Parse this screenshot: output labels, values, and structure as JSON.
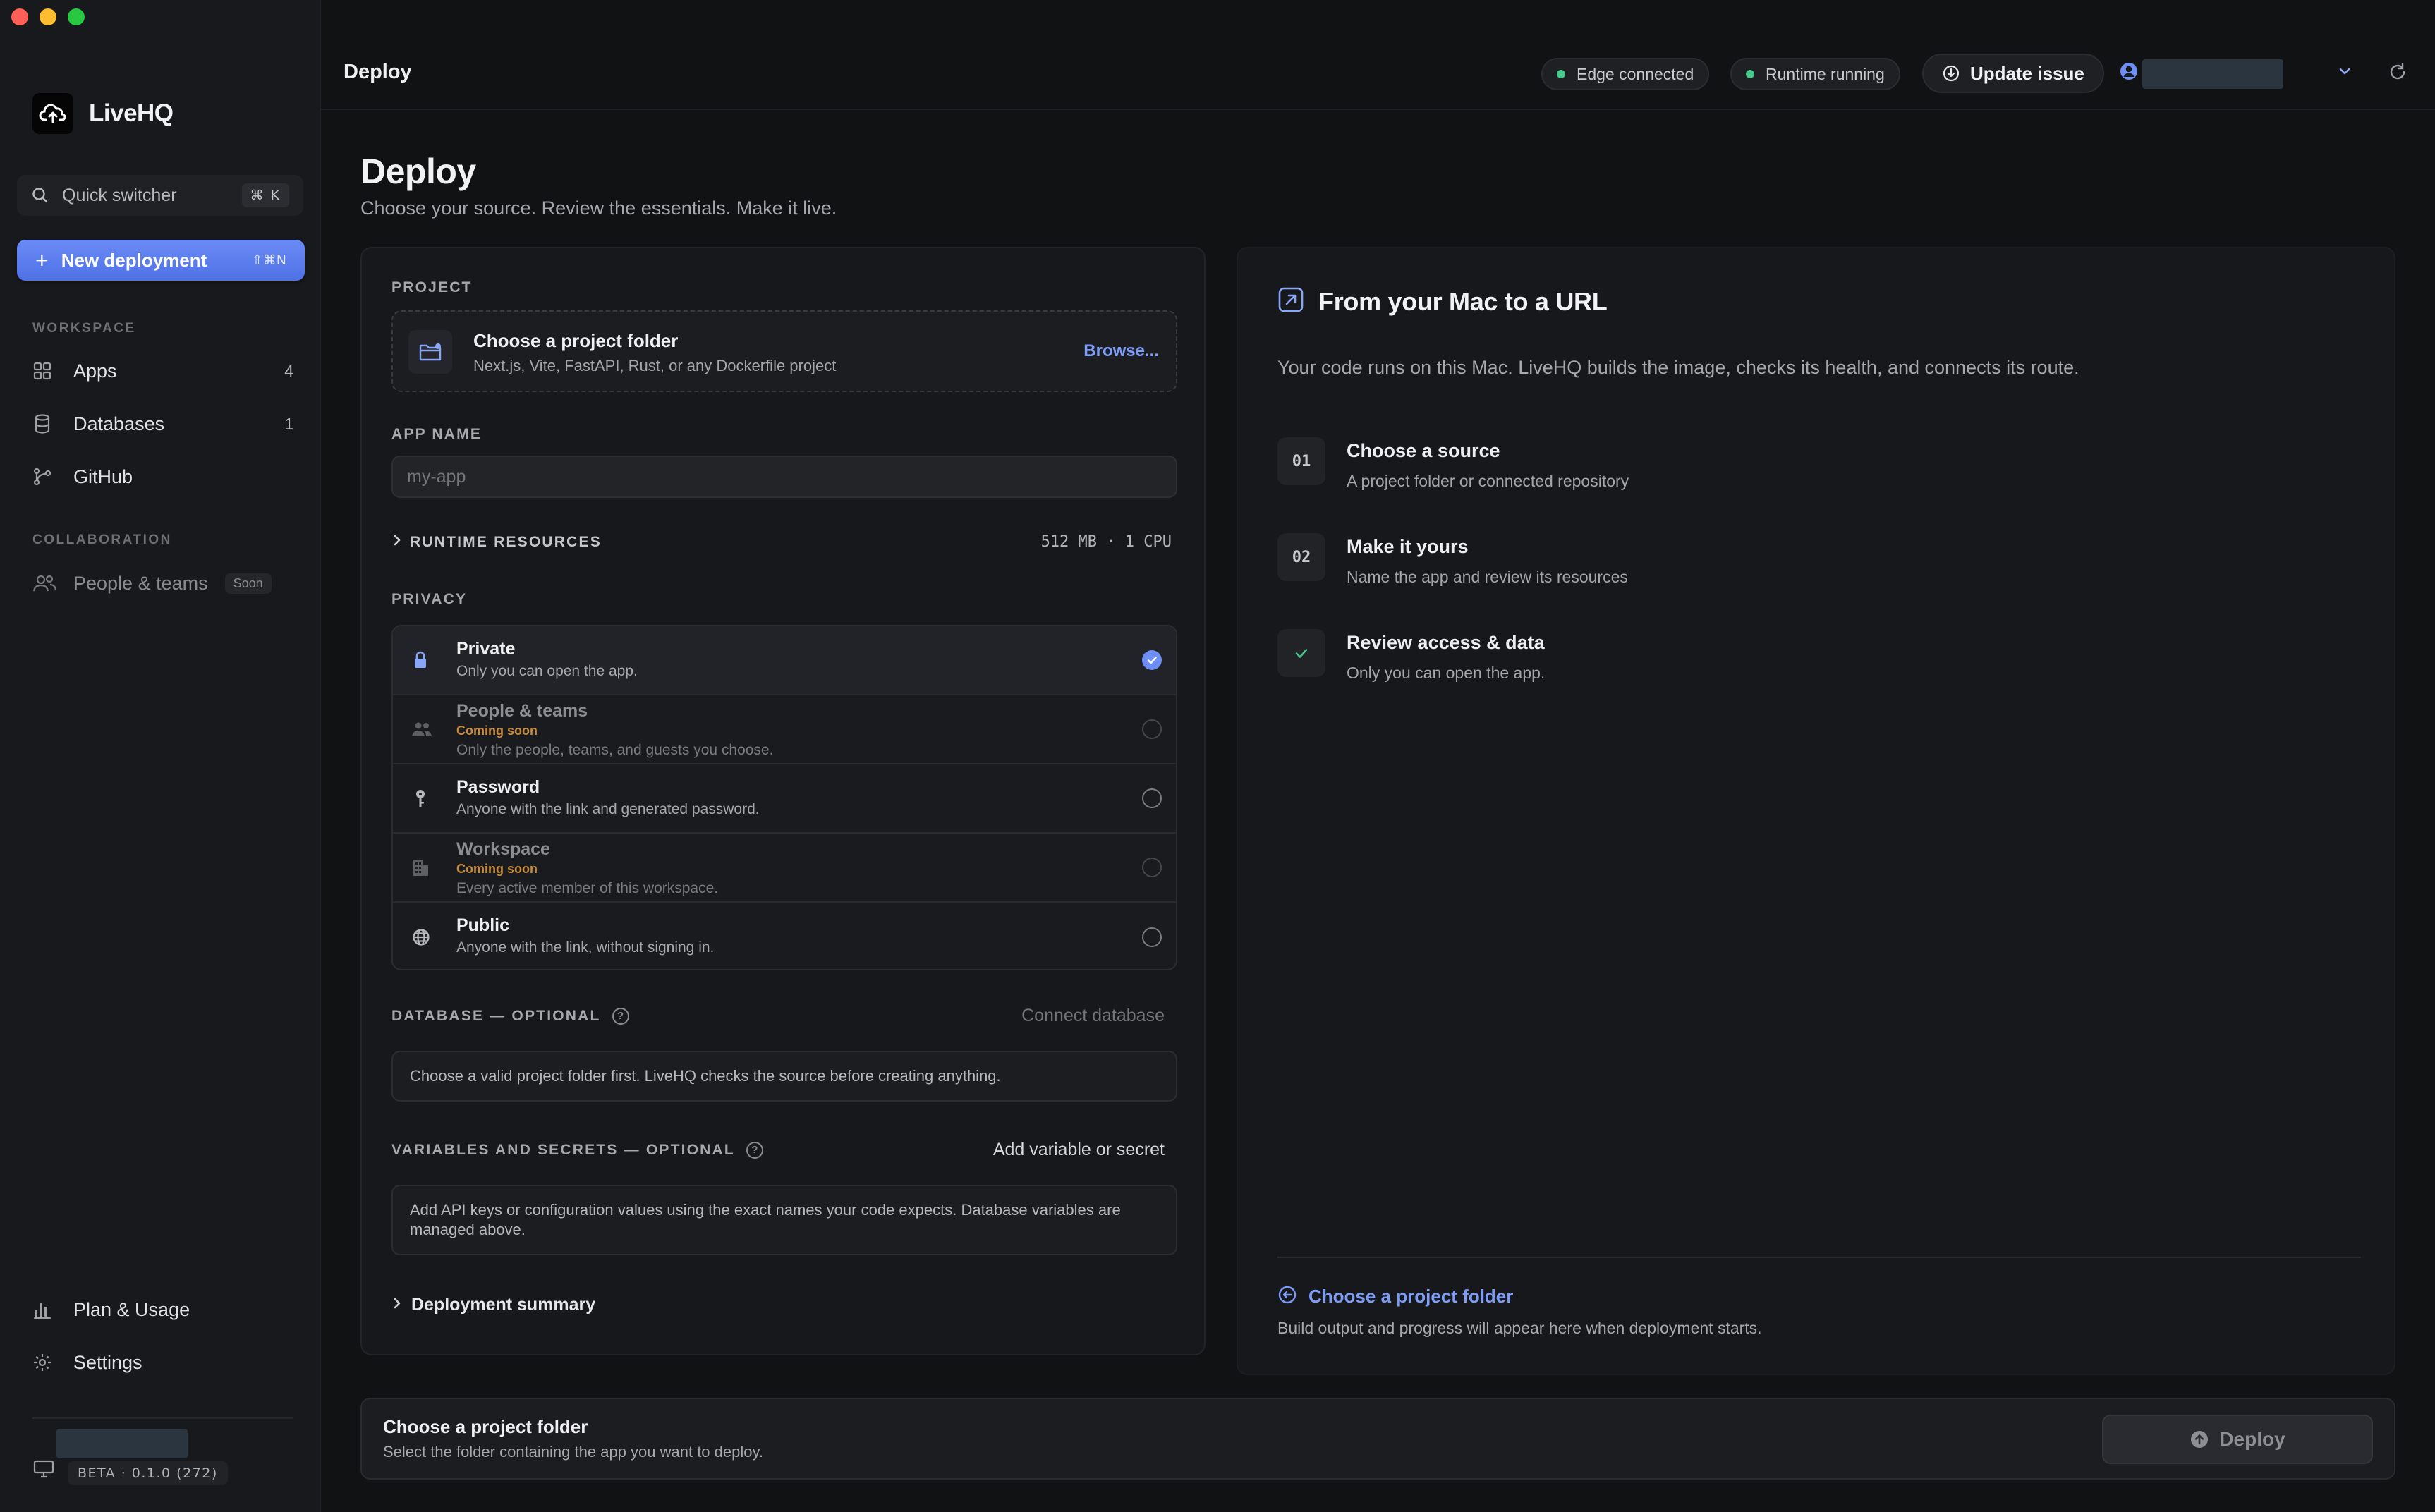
{
  "app": {
    "name": "LiveHQ"
  },
  "sidebar": {
    "quick_switcher": {
      "label": "Quick switcher",
      "shortcut": "⌘ K"
    },
    "new_deployment": {
      "label": "New deployment",
      "shortcut": "⇧⌘N"
    },
    "workspace_label": "WORKSPACE",
    "workspace_items": [
      {
        "label": "Apps",
        "count": "4",
        "icon": "apps-grid-icon"
      },
      {
        "label": "Databases",
        "count": "1",
        "icon": "database-icon"
      },
      {
        "label": "GitHub",
        "count": "",
        "icon": "github-branch-icon"
      }
    ],
    "collaboration_label": "COLLABORATION",
    "collaboration_items": [
      {
        "label": "People & teams",
        "badge": "Soon",
        "icon": "people-icon"
      }
    ],
    "bottom_items": [
      {
        "label": "Plan & Usage",
        "icon": "bar-chart-icon"
      },
      {
        "label": "Settings",
        "icon": "gear-icon"
      }
    ],
    "version": "BETA · 0.1.0 (272)"
  },
  "topbar": {
    "title": "Deploy",
    "status_edge": "Edge connected",
    "status_runtime": "Runtime running",
    "update_button": "Update issue",
    "status_color": "#46c98a"
  },
  "page": {
    "title": "Deploy",
    "subtitle": "Choose your source. Review the essentials. Make it live."
  },
  "form": {
    "project_label": "PROJECT",
    "project_title": "Choose a project folder",
    "project_subtitle": "Next.js, Vite, FastAPI, Rust, or any Dockerfile project",
    "browse_label": "Browse...",
    "app_name_label": "APP NAME",
    "app_name_placeholder": "my-app",
    "app_name_value": "",
    "runtime_label": "RUNTIME RESOURCES",
    "runtime_value": "512 MB · 1 CPU",
    "privacy_label": "PRIVACY",
    "privacy_options": [
      {
        "title": "Private",
        "soon": "",
        "desc": "Only you can open the app.",
        "selected": true,
        "disabled": false,
        "icon": "lock-icon"
      },
      {
        "title": "People & teams",
        "soon": "Coming soon",
        "desc": "Only the people, teams, and guests you choose.",
        "selected": false,
        "disabled": true,
        "icon": "people-icon"
      },
      {
        "title": "Password",
        "soon": "",
        "desc": "Anyone with the link and generated password.",
        "selected": false,
        "disabled": false,
        "icon": "key-icon"
      },
      {
        "title": "Workspace",
        "soon": "Coming soon",
        "desc": "Every active member of this workspace.",
        "selected": false,
        "disabled": true,
        "icon": "building-icon"
      },
      {
        "title": "Public",
        "soon": "",
        "desc": "Anyone with the link, without signing in.",
        "selected": false,
        "disabled": false,
        "icon": "globe-icon"
      }
    ],
    "database_label": "DATABASE — OPTIONAL",
    "database_action": "Connect database",
    "database_note": "Choose a valid project folder first. LiveHQ checks the source before creating anything.",
    "variables_label": "VARIABLES AND SECRETS — OPTIONAL",
    "variables_action": "Add variable or secret",
    "variables_note": "Add API keys or configuration values using the exact names your code expects. Database variables are managed above.",
    "summary_label": "Deployment summary"
  },
  "info": {
    "title": "From your Mac to a URL",
    "description": "Your code runs on this Mac. LiveHQ builds the image, checks its health, and connects its route.",
    "steps": [
      {
        "badge": "01",
        "title": "Choose a source",
        "desc": "A project folder or connected repository"
      },
      {
        "badge": "02",
        "title": "Make it yours",
        "desc": "Name the app and review its resources"
      },
      {
        "badge": "",
        "title": "Review access & data",
        "desc": "Only you can open the app."
      }
    ],
    "link_label": "Choose a project folder",
    "footer_note": "Build output and progress will appear here when deployment starts."
  },
  "bottombar": {
    "title": "Choose a project folder",
    "subtitle": "Select the folder containing the app you want to deploy.",
    "deploy_label": "Deploy"
  },
  "colors": {
    "accent": "#6d8ff5",
    "link": "#7d9cf6",
    "coming_soon": "#c58a3c"
  }
}
